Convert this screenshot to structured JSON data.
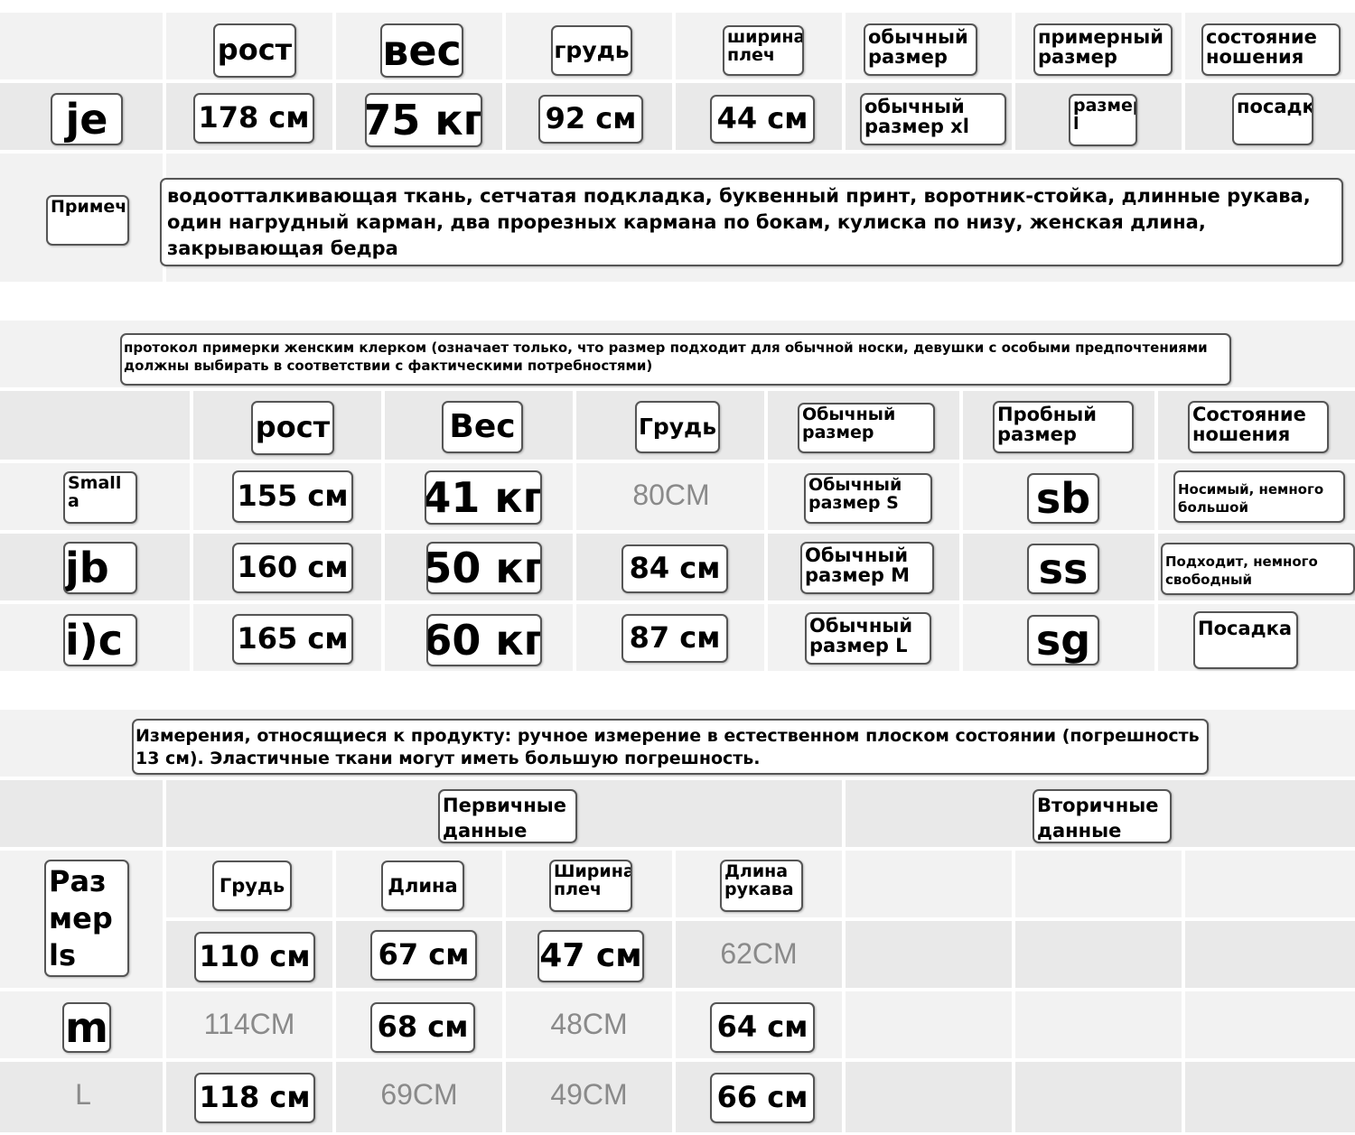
{
  "section1": {
    "headers": [
      "рост",
      "вес",
      "грудь",
      "ширина плеч",
      "обычный размер",
      "примерный размер",
      "состояние ношения"
    ],
    "row": {
      "label": "je",
      "values": [
        "178 см",
        "75 кг",
        "92 см",
        "44 см",
        "обычный размер xl",
        "размер l",
        "посадка"
      ]
    },
    "note_label": "Примечания",
    "note_text": "водоотталкивающая ткань, сетчатая подкладка, буквенный принт, воротник-стойка, длинные рукава, один нагрудный карман, два прорезных кармана по бокам, кулиска по низу, женская длина, закрывающая бедра"
  },
  "section2": {
    "protocol": "протокол примерки женским клерком (означает только, что размер подходит для обычной носки, девушки с особыми предпочтениями должны выбирать в соответствии с фактическими потребностями)",
    "headers": [
      "рост",
      "Вес",
      "Грудь",
      "Обычный размер",
      "Пробный размер",
      "Состояние ношения"
    ],
    "rows": [
      {
        "label": "Small a",
        "values": [
          "155 см",
          "41 кг",
          "80CM",
          "Обычный размер S",
          "sb",
          "Носимый, немного большой"
        ]
      },
      {
        "label": "jb",
        "values": [
          "160 см",
          "50 кг",
          "84 см",
          "Обычный размер M",
          "ss",
          "Подходит, немного свободный"
        ]
      },
      {
        "label": "i)c",
        "values": [
          "165 см",
          "60 кг",
          "87 см",
          "Обычный размер L",
          "sg",
          "Посадка"
        ]
      }
    ]
  },
  "section3": {
    "measure_note": "Измерения, относящиеся к продукту: ручное измерение в естественном плоском состоянии (погрешность 13 см). Эластичные ткани могут иметь большую погрешность.",
    "primary_label": "Первичные данные",
    "secondary_label": "Вторичные данные",
    "size_label": "Размер ls",
    "headers": [
      "Грудь",
      "Длина",
      "Ширина плеч",
      "Длина рукава"
    ],
    "rows": [
      {
        "label": "",
        "values": [
          "110 см",
          "67 см",
          "47 см",
          "62CM"
        ]
      },
      {
        "label": "m",
        "values": [
          "114CM",
          "68 см",
          "48CM",
          "64 см"
        ]
      },
      {
        "label": "L",
        "values": [
          "118 см",
          "69CM",
          "49CM",
          "66 см"
        ]
      }
    ]
  }
}
